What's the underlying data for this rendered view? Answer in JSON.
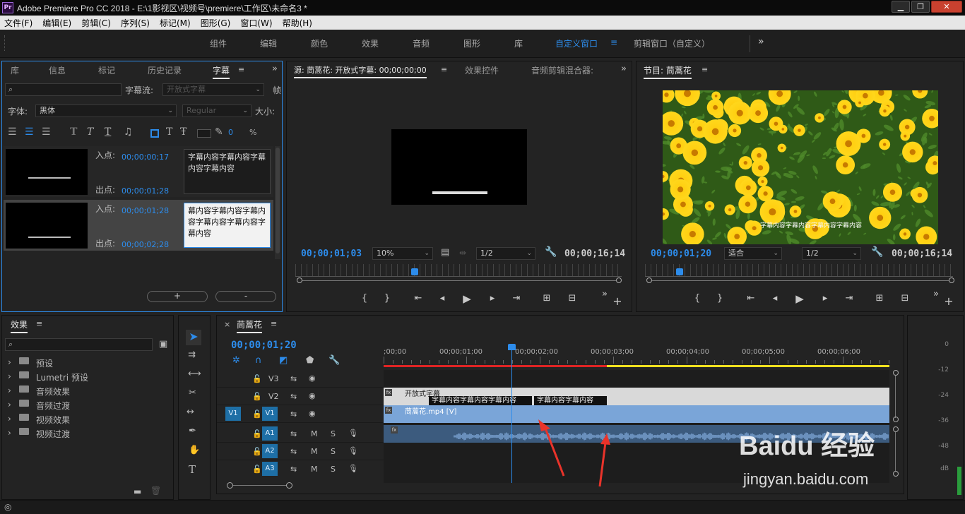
{
  "app": {
    "title": "Adobe Premiere Pro CC 2018 - E:\\1影视区\\视频号\\premiere\\工作区\\未命名3 *",
    "icon": "Pr"
  },
  "window_controls": {
    "minimize": "▁",
    "maximize": "❐",
    "close": "✕"
  },
  "menu": [
    "文件(F)",
    "编辑(E)",
    "剪辑(C)",
    "序列(S)",
    "标记(M)",
    "图形(G)",
    "窗口(W)",
    "帮助(H)"
  ],
  "workspaces": [
    "组件",
    "编辑",
    "颜色",
    "效果",
    "音频",
    "图形",
    "库",
    "自定义窗口",
    "剪辑窗口（自定义）"
  ],
  "workspace_active_index": 7,
  "workspace_more": "»",
  "captions_panel": {
    "tabs": [
      "库",
      "信息",
      "标记",
      "历史记录",
      "字幕"
    ],
    "active_tab": "字幕",
    "stream_label": "字幕流:",
    "stream_value": "开放式字幕",
    "frame_label": "帧",
    "font_label": "字体:",
    "font_value": "黑体",
    "style_value": "Regular",
    "size_label": "大小:",
    "opacity_value": "0",
    "percent": "%",
    "entries": [
      {
        "in_label": "入点:",
        "in": "00;00;00;17",
        "out_label": "出点:",
        "out": "00;00;01;28",
        "text": "字幕内容字幕内容字幕内容字幕内容",
        "selected": false
      },
      {
        "in_label": "入点:",
        "in": "00;00;01;28",
        "out_label": "出点:",
        "out": "00;00;02;28",
        "text": "幕内容字幕内容字幕内容字幕内容字幕内容字幕内容",
        "selected": true
      }
    ],
    "add": "+",
    "remove": "-"
  },
  "source_monitor": {
    "tabs": [
      "源: 茼蒿花: 开放式字幕: 00;00;00;00",
      "效果控件",
      "音频剪辑混合器:"
    ],
    "timecode": "00;00;01;03",
    "zoom": "10%",
    "res": "1/2",
    "duration": "00;00;16;14",
    "playhead": 0.066
  },
  "program_monitor": {
    "title": "节目: 茼蒿花",
    "timecode": "00;00;01;20",
    "zoom": "适合",
    "res": "1/2",
    "duration": "00;00;16;14",
    "playhead": 0.101,
    "caption_overlay": "字幕内容字幕内容字幕内容字幕内容"
  },
  "effects_panel": {
    "title": "效果",
    "items": [
      "预设",
      "Lumetri 预设",
      "音频效果",
      "音频过渡",
      "视频效果",
      "视频过渡"
    ]
  },
  "timeline": {
    "sequence": "茼蒿花",
    "timecode": "00;00;01;20",
    "ruler": [
      ";00;00",
      "00;00;01;00",
      "00;00;02;00",
      "00;00;03;00",
      "00;00;04;00",
      "00;00;05;00",
      "00;00;06;00"
    ],
    "playhead_seconds": 1.67,
    "tracks": {
      "video": [
        "V3",
        "V2",
        "V1"
      ],
      "audio": [
        "A1",
        "A2",
        "A3"
      ],
      "src": "V1"
    },
    "audio_buttons": {
      "mute": "M",
      "solo": "S"
    },
    "clips": {
      "caption_clip": "开放式字幕",
      "caption1": "字幕内容字幕内容字幕内容",
      "caption2": "字幕内容字幕内容",
      "video_clip": "茼蒿花.mp4 [V]",
      "fx": "fx"
    }
  },
  "meter": {
    "scale": [
      "0",
      "-12",
      "-24",
      "-36",
      "-48",
      "dB"
    ]
  },
  "watermark": {
    "brand": "Baidu 经验",
    "url": "jingyan.baidu.com"
  },
  "colors": {
    "accent": "#2d8ceb",
    "video_clip": "#7aa5d8",
    "audio_clip": "#3c5b7e",
    "caption_clip": "#d9d9d9",
    "render_red": "#e02424",
    "render_yellow": "#f2e11f"
  }
}
